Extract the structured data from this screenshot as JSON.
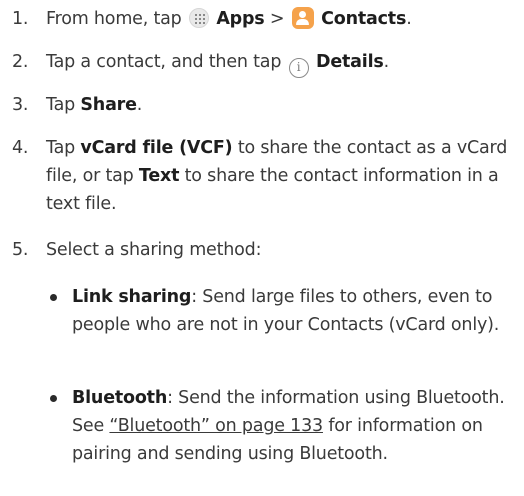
{
  "steps": [
    {
      "num": "1.",
      "pre": "From home, tap",
      "apps_label": "Apps",
      "sep": ">",
      "contacts_label": "Contacts",
      "end": "."
    },
    {
      "num": "2.",
      "pre": "Tap a contact, and then tap",
      "details_label": "Details",
      "end": "."
    },
    {
      "num": "3.",
      "pre": "Tap",
      "share_label": "Share",
      "end": "."
    },
    {
      "num": "4.",
      "pre": "Tap",
      "vcard_label": "vCard file (VCF)",
      "mid": "to share the contact as a vCard file, or tap",
      "text_label": "Text",
      "post": "to share the contact information in a text file."
    },
    {
      "num": "5.",
      "text": "Select a sharing method:"
    }
  ],
  "bullets": [
    {
      "label": "Link sharing",
      "text": ": Send large files to others, even to people who are not in your Contacts (vCard only)."
    },
    {
      "label": "Bluetooth",
      "text1": ": Send the information using Bluetooth. See",
      "link": "“Bluetooth” on page 133",
      "text2": "for information on pairing and sending using Bluetooth."
    }
  ],
  "icons": {
    "apps": "apps-grid-icon",
    "contacts": "contacts-app-icon",
    "details": "info-icon"
  },
  "colors": {
    "text": "#3a3a3a",
    "contacts_icon": "#f5a24b"
  }
}
